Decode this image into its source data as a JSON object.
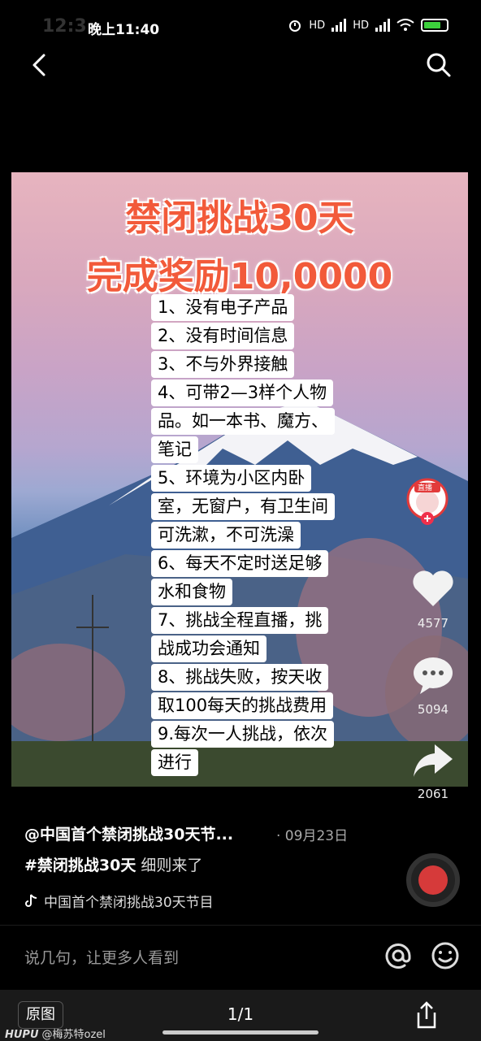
{
  "status_bar": {
    "ghost_time": "12:3",
    "time": "晚上11:40",
    "network_1": "HD",
    "network_2": "HD"
  },
  "poster": {
    "title_line1": "禁闭挑战30天",
    "title_line2": "完成奖励10,0000",
    "rules": [
      "1、没有电子产品",
      "2、没有时间信息",
      "3、不与外界接触",
      "4、可带2—3样个人物",
      "品。如一本书、魔方、",
      "笔记",
      "5、环境为小区内卧",
      "室，无窗户，有卫生间",
      "可洗漱，不可洗澡",
      "6、每天不定时送足够",
      "水和食物",
      "7、挑战全程直播，挑",
      "战成功会通知",
      "8、挑战失败，按天收",
      "取100每天的挑战费用",
      "9.每次一人挑战，依次",
      "进行"
    ]
  },
  "actions": {
    "live_badge": "直播",
    "likes": "4577",
    "comments": "5094",
    "shares": "2061"
  },
  "post": {
    "author": "@中国首个禁闭挑战30天节...",
    "date": "· 09月23日",
    "hashtag": "#禁闭挑战30天",
    "description": "细则来了",
    "music": "中国首个禁闭挑战30天节目"
  },
  "comment_input": {
    "placeholder": "说几句，让更多人看到"
  },
  "viewer": {
    "original_button": "原图",
    "page_indicator": "1/1"
  },
  "watermark": {
    "brand": "HUPU",
    "user": "@梅苏特ozel"
  },
  "colors": {
    "title_red": "#f25a3a",
    "background": "#000000"
  }
}
